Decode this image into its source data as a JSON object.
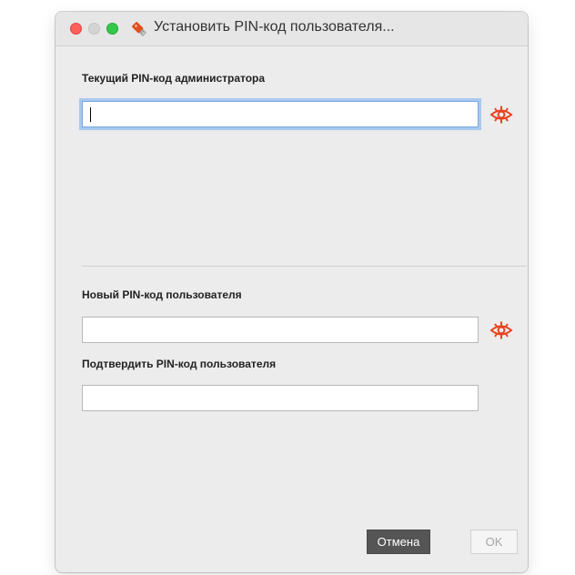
{
  "window": {
    "title": "Установить PIN-код пользователя..."
  },
  "admin_section": {
    "label": "Текущий PIN-код администратора",
    "value": ""
  },
  "user_section": {
    "new_label": "Новый PIN-код пользователя",
    "new_value": "",
    "confirm_label": "Подтвердить PIN-код пользователя",
    "confirm_value": ""
  },
  "buttons": {
    "cancel_label": "Отмена",
    "ok_label": "OK"
  },
  "icons": {
    "app": "usb-key-icon",
    "reveal": "eye-icon"
  },
  "colors": {
    "accent_eye": "#e8421c",
    "focus_ring": "#a9c8f0"
  }
}
